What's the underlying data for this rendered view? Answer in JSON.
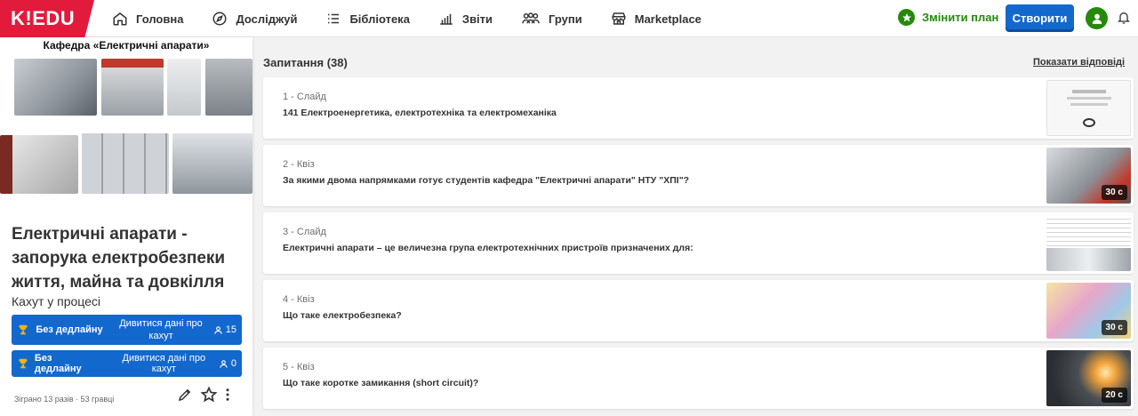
{
  "logo": "K!EDU",
  "nav": [
    {
      "label": "Головна",
      "icon": "home-icon"
    },
    {
      "label": "Досліджуй",
      "icon": "compass-icon"
    },
    {
      "label": "Бібліотека",
      "icon": "list-icon"
    },
    {
      "label": "Звіти",
      "icon": "bar-chart-icon"
    },
    {
      "label": "Групи",
      "icon": "people-icon"
    },
    {
      "label": "Marketplace",
      "icon": "store-icon"
    }
  ],
  "header": {
    "upgrade_label": "Змінити план",
    "create_label": "Створити"
  },
  "kahoot": {
    "cover_title": "Кафедра «Електричні апарати»",
    "title": "Електричні апарати - запорука електробезпеки життя, майна та довкілля",
    "status": "Кахут у процесі",
    "assignments": [
      {
        "deadline": "Без дедлайну",
        "view": "Дивитися дані про кахут",
        "players": "15"
      },
      {
        "deadline": "Без дедлайну",
        "view": "Дивитися дані про кахут",
        "players": "0"
      }
    ],
    "played": "Зіграно 13 разів · 53 гравці"
  },
  "questions_header": "Запитання (38)",
  "show_answers": "Показати відповіді",
  "questions": [
    {
      "type": "1 - Слайд",
      "text": "141 Електроенергетика, електротехніка та електромеханіка",
      "time": ""
    },
    {
      "type": "2 - Квіз",
      "text": "За якими двома напрямками готує студентів кафедра \"Електричні апарати\" НТУ \"ХПІ\"?",
      "time": "30 с"
    },
    {
      "type": "3 - Слайд",
      "text": "Електричні апарати – це величезна група електротехнічних пристроїв призначених для:",
      "time": ""
    },
    {
      "type": "4 - Квіз",
      "text": "Що таке електробезпека?",
      "time": "30 с"
    },
    {
      "type": "5 - Квіз",
      "text": "Що таке коротке замикання (short circuit)?",
      "time": "20 с"
    }
  ],
  "colors": {
    "brand": "#e21b3c",
    "primary": "#1368ce",
    "green": "#26890c"
  }
}
